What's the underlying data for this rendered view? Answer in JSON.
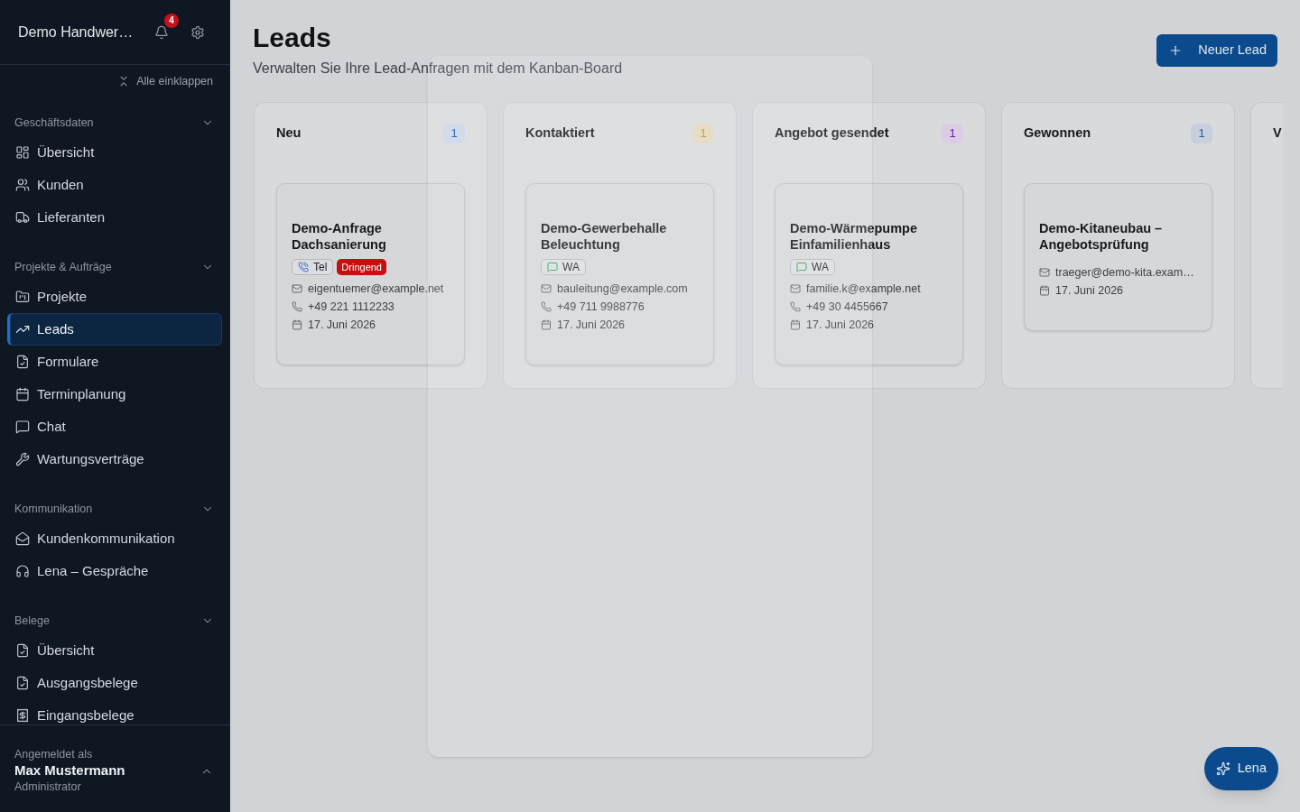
{
  "sidebar": {
    "brand": "Demo Handwer…",
    "notification_count": "4",
    "collapse_all": "Alle einklappen",
    "sections": [
      {
        "title": "Geschäftsdaten",
        "expanded": true,
        "items": [
          {
            "label": "Übersicht",
            "selected": false
          },
          {
            "label": "Kunden",
            "selected": false
          },
          {
            "label": "Lieferanten",
            "selected": false
          }
        ]
      },
      {
        "title": "Projekte & Aufträge",
        "expanded": true,
        "items": [
          {
            "label": "Projekte",
            "selected": false
          },
          {
            "label": "Leads",
            "selected": true
          },
          {
            "label": "Formulare",
            "selected": false
          },
          {
            "label": "Terminplanung",
            "selected": false
          },
          {
            "label": "Chat",
            "selected": false
          },
          {
            "label": "Wartungsverträge",
            "selected": false
          }
        ]
      },
      {
        "title": "Kommunikation",
        "expanded": true,
        "items": [
          {
            "label": "Kundenkommunikation",
            "selected": false
          },
          {
            "label": "Lena – Gespräche",
            "selected": false
          }
        ]
      },
      {
        "title": "Belege",
        "expanded": true,
        "items": [
          {
            "label": "Übersicht",
            "selected": false
          },
          {
            "label": "Ausgangsbelege",
            "selected": false
          },
          {
            "label": "Eingangsbelege",
            "selected": false
          }
        ]
      }
    ],
    "user": {
      "caption": "Angemeldet als",
      "name": "Max Mustermann",
      "role": "Administrator"
    }
  },
  "header": {
    "title": "Leads",
    "subtitle": "Verwalten Sie Ihre Lead-Anfragen mit dem Kanban-Board",
    "new_button": "Neuer Lead"
  },
  "board": {
    "columns": [
      {
        "title": "Neu",
        "count": "1",
        "color": "#cbd5e6",
        "cards": [
          {
            "title": "Demo-Anfrage Dachsanierung",
            "tags": [
              {
                "kind": "phone",
                "label": "Tel"
              },
              {
                "kind": "urgent",
                "label": "Dringend"
              }
            ],
            "details": [
              {
                "kind": "email",
                "text": "eigentuemer@example.net"
              },
              {
                "kind": "phone",
                "text": "+49 221 1112233"
              },
              {
                "kind": "date",
                "text": "17. Juni 2026"
              }
            ]
          }
        ]
      },
      {
        "title": "Kontaktiert",
        "count": "1",
        "color": "#e1d8bd",
        "cards": [
          {
            "title": "Demo-Gewerbehalle Beleuchtung",
            "tags": [
              {
                "kind": "whatsapp",
                "label": "WA"
              }
            ],
            "details": [
              {
                "kind": "email",
                "text": "bauleitung@example.com"
              },
              {
                "kind": "phone",
                "text": "+49 711 9988776"
              },
              {
                "kind": "date",
                "text": "17. Juni 2026"
              }
            ]
          }
        ]
      },
      {
        "title": "Angebot gesendet",
        "count": "1",
        "color": "#dacde4",
        "cards": [
          {
            "title": "Demo-Wärmepumpe Einfamilienhaus",
            "tags": [
              {
                "kind": "whatsapp",
                "label": "WA"
              }
            ],
            "details": [
              {
                "kind": "email",
                "text": "familie.k@example.net"
              },
              {
                "kind": "phone",
                "text": "+49 30 4455667"
              },
              {
                "kind": "date",
                "text": "17. Juni 2026"
              }
            ]
          }
        ]
      },
      {
        "title": "Gewonnen",
        "count": "1",
        "color": "#c6cfdb",
        "cards": [
          {
            "title": "Demo-Kitaneubau – Angebotsprüfung",
            "details": [
              {
                "kind": "email",
                "text": "traeger@demo-kita.exam…"
              },
              {
                "kind": "date",
                "text": "17. Juni 2026"
              }
            ]
          }
        ]
      },
      {
        "title": "V"
      }
    ]
  },
  "dialog": {
    "visible": true
  },
  "assistant_button": {
    "label": "Lena"
  }
}
